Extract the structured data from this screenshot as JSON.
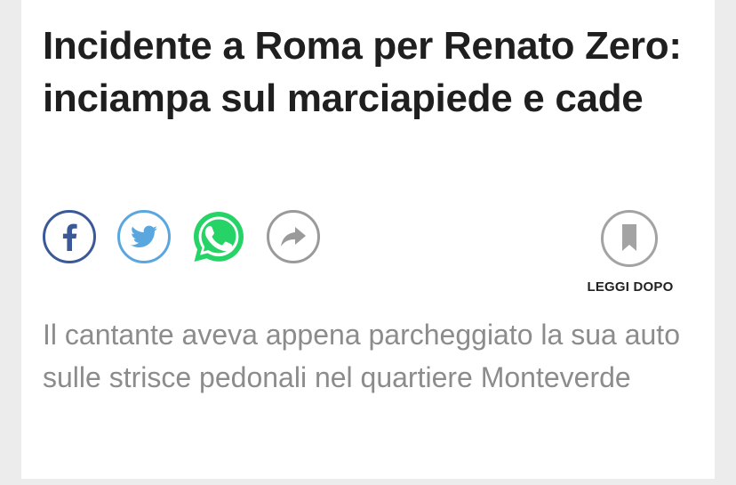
{
  "article": {
    "headline": "Incidente a Roma per Renato Zero: inciampa sul marciapiede e cade",
    "summary": "Il cantante aveva appena parcheggiato la sua auto sulle strisce pedonali nel quartiere Monteverde"
  },
  "share": {
    "buttons": [
      {
        "icon": "facebook-icon",
        "color": "#3b5998"
      },
      {
        "icon": "twitter-icon",
        "color": "#5aa7e0"
      },
      {
        "icon": "whatsapp-icon",
        "color": "#25d366"
      },
      {
        "icon": "share-icon",
        "color": "#9a9a9a"
      }
    ]
  },
  "read_later": {
    "label": "LEGGI DOPO",
    "icon": "bookmark-icon"
  }
}
